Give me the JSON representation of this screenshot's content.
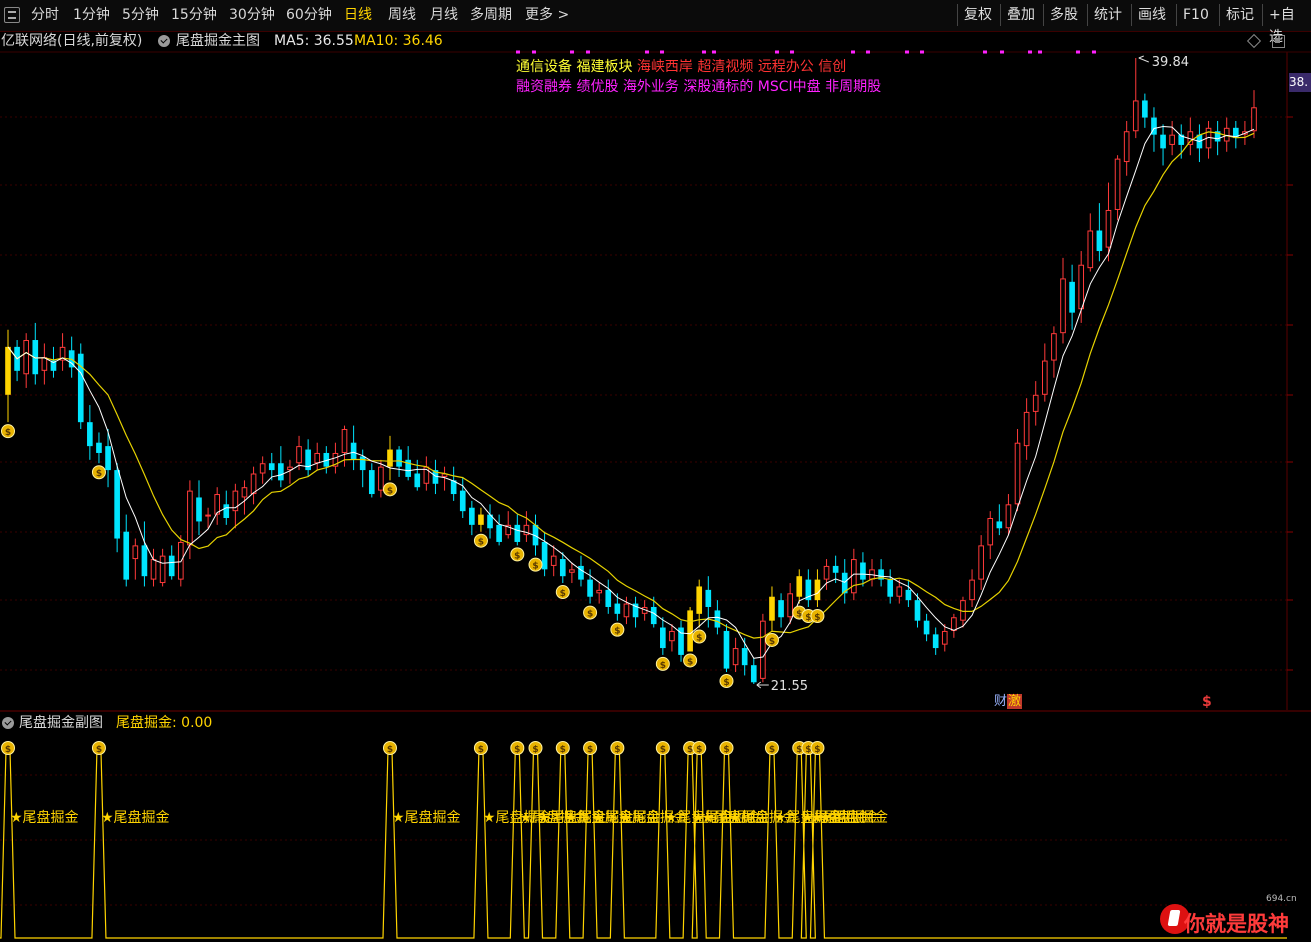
{
  "toolbar": {
    "periods": [
      {
        "label": "分时",
        "active": false
      },
      {
        "label": "1分钟",
        "active": false
      },
      {
        "label": "5分钟",
        "active": false
      },
      {
        "label": "15分钟",
        "active": false
      },
      {
        "label": "30分钟",
        "active": false
      },
      {
        "label": "60分钟",
        "active": false
      },
      {
        "label": "日线",
        "active": true
      },
      {
        "label": "周线",
        "active": false
      },
      {
        "label": "月线",
        "active": false
      },
      {
        "label": "多周期",
        "active": false
      },
      {
        "label": "更多 >",
        "active": false
      }
    ],
    "right_buttons": [
      "复权",
      "叠加",
      "多股",
      "统计",
      "画线",
      "F10",
      "标记",
      "+自选"
    ]
  },
  "main_chart": {
    "stock_title": "亿联网络(日线,前复权)",
    "indicator_name": "尾盘掘金主图",
    "ma5_label": "MA5: 36.55",
    "ma10_label": "MA10: 36.46",
    "concept_tags_row1": [
      {
        "text": "通信设备",
        "color": "#ffff33"
      },
      {
        "text": "福建板块",
        "color": "#ffff33"
      },
      {
        "text": "海峡西岸",
        "color": "#ff3333"
      },
      {
        "text": "超清视频",
        "color": "#ff3333"
      },
      {
        "text": "远程办公",
        "color": "#ff3333"
      },
      {
        "text": "信创",
        "color": "#ff3333"
      }
    ],
    "concept_tags_row2": "融资融券 绩优股 海外业务 深股通标的 MSCI中盘 非周期股",
    "high_label": "39.84",
    "low_label": "21.55",
    "price_badge": "38.",
    "badge_cai": "财",
    "badge_ji": "激",
    "dollar_mark": "$",
    "colors": {
      "up": "#ff3a3a",
      "down": "#00e5ff",
      "signal": "#ffd400",
      "ma5": "#ffffff",
      "ma10": "#e6d200",
      "tag2": "#ff22ff"
    }
  },
  "sub_chart": {
    "title": "尾盘掘金副图",
    "value_label": "尾盘掘金: 0.00",
    "signal_label": "★尾盘掘金"
  },
  "watermark": {
    "text": "你就是股神",
    "site": "694.cn"
  },
  "chart_data": {
    "type": "candlestick",
    "price_range_visible": [
      21.55,
      39.84
    ],
    "high_value": 39.84,
    "low_value": 21.55,
    "candles": [
      [
        30.0,
        31.4,
        31.9,
        29.2
      ],
      [
        31.4,
        30.7,
        31.6,
        30.4
      ],
      [
        30.6,
        31.6,
        31.8,
        30.2
      ],
      [
        31.6,
        30.6,
        32.1,
        30.3
      ],
      [
        30.7,
        31.1,
        31.5,
        30.3
      ],
      [
        31.0,
        30.7,
        31.4,
        30.5
      ],
      [
        31.0,
        31.4,
        31.8,
        30.7
      ],
      [
        31.3,
        30.8,
        31.7,
        30.5
      ],
      [
        31.2,
        29.2,
        31.5,
        29.0
      ],
      [
        29.2,
        28.5,
        29.7,
        28.1
      ],
      [
        28.6,
        28.3,
        28.9,
        28.0
      ],
      [
        28.5,
        27.8,
        29.0,
        27.3
      ],
      [
        27.8,
        25.8,
        28.0,
        25.4
      ],
      [
        26.0,
        24.6,
        26.5,
        24.4
      ],
      [
        25.2,
        25.6,
        25.8,
        24.6
      ],
      [
        25.6,
        24.7,
        26.3,
        24.4
      ],
      [
        24.6,
        25.2,
        25.5,
        24.4
      ],
      [
        24.5,
        25.3,
        25.5,
        24.4
      ],
      [
        25.3,
        24.7,
        25.6,
        24.6
      ],
      [
        24.6,
        25.7,
        25.9,
        24.4
      ],
      [
        25.6,
        27.2,
        27.5,
        25.2
      ],
      [
        27.0,
        26.3,
        27.5,
        25.9
      ],
      [
        26.5,
        26.5,
        26.7,
        26.1
      ],
      [
        26.5,
        27.1,
        27.3,
        26.2
      ],
      [
        26.8,
        26.4,
        27.2,
        26.2
      ],
      [
        26.6,
        27.2,
        27.4,
        26.1
      ],
      [
        27.0,
        27.3,
        27.5,
        26.5
      ],
      [
        27.1,
        27.7,
        27.9,
        26.8
      ],
      [
        27.7,
        28.0,
        28.2,
        27.4
      ],
      [
        28.0,
        27.8,
        28.3,
        27.5
      ],
      [
        28.0,
        27.5,
        28.5,
        27.3
      ],
      [
        27.8,
        27.9,
        28.1,
        27.4
      ],
      [
        28.0,
        28.5,
        28.8,
        27.8
      ],
      [
        28.4,
        27.8,
        28.7,
        27.6
      ],
      [
        28.0,
        28.3,
        28.6,
        27.8
      ],
      [
        28.3,
        27.9,
        28.5,
        27.7
      ],
      [
        27.9,
        28.3,
        28.6,
        27.7
      ],
      [
        28.3,
        29.0,
        29.1,
        27.9
      ],
      [
        28.6,
        28.1,
        29.1,
        27.8
      ],
      [
        28.2,
        27.8,
        28.4,
        27.3
      ],
      [
        27.8,
        27.1,
        28.0,
        27.0
      ],
      [
        27.2,
        27.9,
        28.1,
        27.0
      ],
      [
        27.9,
        28.4,
        28.8,
        27.5
      ],
      [
        28.4,
        27.9,
        28.5,
        27.6
      ],
      [
        28.1,
        27.6,
        28.5,
        27.5
      ],
      [
        27.7,
        27.3,
        28.1,
        27.2
      ],
      [
        27.4,
        27.9,
        28.2,
        27.2
      ],
      [
        27.8,
        27.4,
        28.1,
        27.1
      ],
      [
        27.6,
        27.7,
        27.9,
        27.2
      ],
      [
        27.5,
        27.1,
        27.9,
        26.9
      ],
      [
        27.2,
        26.6,
        27.6,
        26.4
      ],
      [
        26.7,
        26.2,
        26.9,
        25.9
      ],
      [
        26.2,
        26.5,
        26.7,
        26.0
      ],
      [
        26.5,
        26.1,
        26.8,
        25.8
      ],
      [
        26.2,
        25.7,
        26.5,
        25.6
      ],
      [
        25.9,
        26.2,
        26.6,
        25.8
      ],
      [
        26.2,
        25.7,
        26.5,
        25.6
      ],
      [
        25.9,
        26.2,
        26.6,
        25.7
      ],
      [
        26.2,
        25.6,
        26.5,
        25.3
      ],
      [
        25.7,
        24.9,
        26.0,
        24.7
      ],
      [
        25.0,
        25.3,
        25.6,
        24.7
      ],
      [
        25.2,
        24.7,
        25.4,
        24.5
      ],
      [
        24.8,
        24.9,
        25.1,
        24.5
      ],
      [
        25.0,
        24.6,
        25.3,
        24.4
      ],
      [
        24.6,
        24.1,
        24.9,
        23.9
      ],
      [
        24.2,
        24.3,
        24.5,
        23.9
      ],
      [
        24.3,
        23.8,
        24.6,
        23.6
      ],
      [
        23.9,
        23.6,
        24.2,
        23.4
      ],
      [
        23.5,
        23.9,
        24.1,
        23.3
      ],
      [
        23.9,
        23.5,
        24.1,
        23.2
      ],
      [
        23.6,
        23.8,
        24.0,
        23.4
      ],
      [
        23.8,
        23.3,
        24.1,
        23.2
      ],
      [
        23.2,
        22.6,
        23.5,
        22.4
      ],
      [
        22.8,
        23.1,
        23.3,
        22.5
      ],
      [
        23.2,
        22.4,
        23.4,
        22.2
      ],
      [
        22.5,
        23.7,
        23.8,
        22.5
      ],
      [
        23.6,
        24.4,
        24.6,
        23.2
      ],
      [
        24.3,
        23.8,
        24.7,
        23.2
      ],
      [
        23.7,
        23.2,
        24.0,
        23.0
      ],
      [
        23.1,
        22.0,
        23.3,
        21.9
      ],
      [
        22.1,
        22.6,
        22.9,
        21.9
      ],
      [
        22.6,
        22.1,
        22.9,
        21.8
      ],
      [
        22.1,
        21.6,
        22.3,
        21.55
      ],
      [
        21.7,
        23.4,
        23.6,
        21.6
      ],
      [
        23.4,
        24.1,
        24.4,
        23.1
      ],
      [
        24.0,
        23.5,
        24.2,
        23.2
      ],
      [
        23.5,
        24.2,
        24.5,
        23.3
      ],
      [
        24.1,
        24.7,
        24.9,
        23.9
      ],
      [
        24.6,
        24.0,
        24.9,
        23.8
      ],
      [
        24.0,
        24.6,
        24.9,
        23.8
      ],
      [
        24.6,
        25.0,
        25.2,
        24.3
      ],
      [
        25.0,
        24.8,
        25.3,
        24.5
      ],
      [
        24.8,
        24.2,
        25.2,
        23.9
      ],
      [
        24.2,
        25.2,
        25.5,
        24.0
      ],
      [
        25.1,
        24.6,
        25.4,
        24.4
      ],
      [
        24.6,
        24.9,
        25.2,
        24.4
      ],
      [
        24.9,
        24.6,
        25.2,
        24.4
      ],
      [
        24.6,
        24.1,
        24.9,
        23.9
      ],
      [
        24.1,
        24.4,
        24.6,
        23.9
      ],
      [
        24.3,
        24.0,
        24.6,
        23.8
      ],
      [
        24.0,
        23.4,
        24.2,
        23.2
      ],
      [
        23.4,
        23.0,
        23.6,
        22.8
      ],
      [
        23.0,
        22.6,
        23.2,
        22.4
      ],
      [
        22.7,
        23.1,
        23.3,
        22.5
      ],
      [
        23.1,
        23.5,
        23.6,
        22.9
      ],
      [
        23.4,
        24.0,
        24.1,
        23.2
      ],
      [
        24.0,
        24.6,
        24.9,
        23.8
      ],
      [
        24.6,
        25.6,
        25.9,
        24.3
      ],
      [
        25.6,
        26.4,
        26.6,
        25.2
      ],
      [
        26.3,
        26.1,
        26.8,
        25.9
      ],
      [
        26.1,
        26.8,
        27.1,
        25.9
      ],
      [
        26.8,
        28.6,
        29.0,
        26.6
      ],
      [
        28.5,
        29.5,
        29.9,
        28.1
      ],
      [
        29.5,
        30.0,
        30.4,
        29.1
      ],
      [
        30.0,
        31.0,
        31.5,
        29.8
      ],
      [
        31.0,
        31.8,
        32.0,
        30.5
      ],
      [
        31.8,
        33.4,
        34.0,
        31.5
      ],
      [
        33.3,
        32.4,
        33.8,
        31.9
      ],
      [
        32.5,
        33.8,
        34.2,
        32.1
      ],
      [
        33.7,
        34.8,
        35.3,
        33.6
      ],
      [
        34.8,
        34.2,
        35.6,
        33.9
      ],
      [
        34.3,
        35.4,
        36.2,
        33.9
      ],
      [
        35.4,
        36.9,
        37.0,
        35.1
      ],
      [
        36.8,
        37.7,
        38.0,
        36.4
      ],
      [
        37.7,
        38.6,
        39.84,
        37.5
      ],
      [
        38.6,
        38.1,
        38.8,
        37.8
      ],
      [
        38.1,
        37.6,
        38.4,
        37.1
      ],
      [
        37.6,
        37.2,
        37.9,
        36.7
      ],
      [
        37.3,
        37.6,
        38.0,
        37.0
      ],
      [
        37.6,
        37.3,
        37.9,
        36.9
      ],
      [
        37.3,
        37.7,
        38.1,
        37.0
      ],
      [
        37.6,
        37.2,
        37.9,
        36.8
      ],
      [
        37.2,
        37.8,
        38.0,
        36.9
      ],
      [
        37.7,
        37.4,
        38.0,
        37.0
      ],
      [
        37.4,
        37.8,
        38.1,
        37.1
      ],
      [
        37.8,
        37.5,
        38.0,
        37.2
      ],
      [
        37.6,
        37.7,
        38.0,
        37.3
      ],
      [
        37.7,
        38.4,
        38.9,
        37.5
      ]
    ],
    "signal_indices": [
      0,
      10,
      42,
      52,
      56,
      58,
      61,
      64,
      67,
      72,
      75,
      76,
      79,
      84,
      87,
      88,
      89
    ]
  }
}
